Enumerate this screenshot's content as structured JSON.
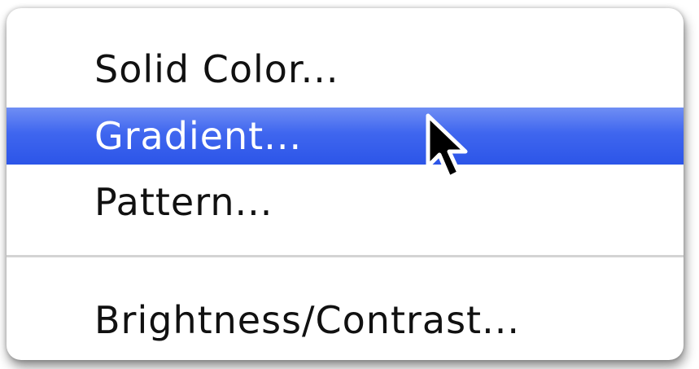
{
  "menu": {
    "items": [
      {
        "label": "Solid Color...",
        "selected": false
      },
      {
        "label": "Gradient...",
        "selected": true
      },
      {
        "label": "Pattern...",
        "selected": false
      },
      {
        "label": "Brightness/Contrast...",
        "selected": false
      }
    ]
  },
  "colors": {
    "highlight": "#3f66ef",
    "highlight_text": "#ffffff",
    "text": "#111111",
    "separator": "#d4d4d4"
  },
  "cursor": {
    "icon": "arrow-pointer-icon"
  }
}
